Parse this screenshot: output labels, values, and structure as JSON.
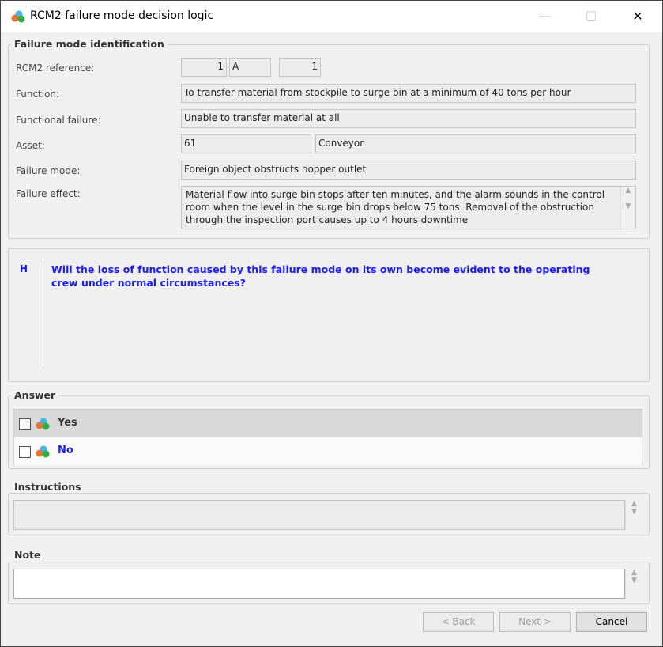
{
  "window": {
    "title": "RCM2 failure mode decision logic",
    "minimize": "—",
    "maximize": "☐",
    "close": "✕"
  },
  "identification": {
    "heading": "Failure mode identification",
    "rcm2_reference_label": "RCM2 reference:",
    "ref1": "1",
    "ref2": "A",
    "ref3": "1",
    "function_label": "Function:",
    "function": "To transfer material from stockpile to surge bin at a minimum of 40 tons per hour",
    "functional_failure_label": "Functional failure:",
    "functional_failure": "Unable to transfer material at all",
    "asset_label": "Asset:",
    "asset_id": "61",
    "asset_name": "Conveyor",
    "failure_mode_label": "Failure mode:",
    "failure_mode": "Foreign object obstructs hopper outlet",
    "failure_effect_label": "Failure effect:",
    "failure_effect": "Material flow into surge bin stops after ten minutes, and the alarm sounds in the control room when the level in the surge bin drops below 75 tons. Removal of the obstruction through the inspection port causes up to 4 hours downtime"
  },
  "question": {
    "code": "H",
    "text": "Will the loss of function caused by this failure mode on its own become evident to the operating crew under normal circumstances?"
  },
  "answer": {
    "heading": "Answer",
    "options": [
      {
        "label": "Yes",
        "checked": false
      },
      {
        "label": "No",
        "checked": false
      }
    ]
  },
  "instructions": {
    "heading": "Instructions",
    "value": ""
  },
  "note": {
    "heading": "Note",
    "value": ""
  },
  "buttons": {
    "back": "< Back",
    "next": "Next >",
    "cancel": "Cancel"
  },
  "colors": {
    "question": "#1a1aff",
    "link": "#1a1aff"
  }
}
